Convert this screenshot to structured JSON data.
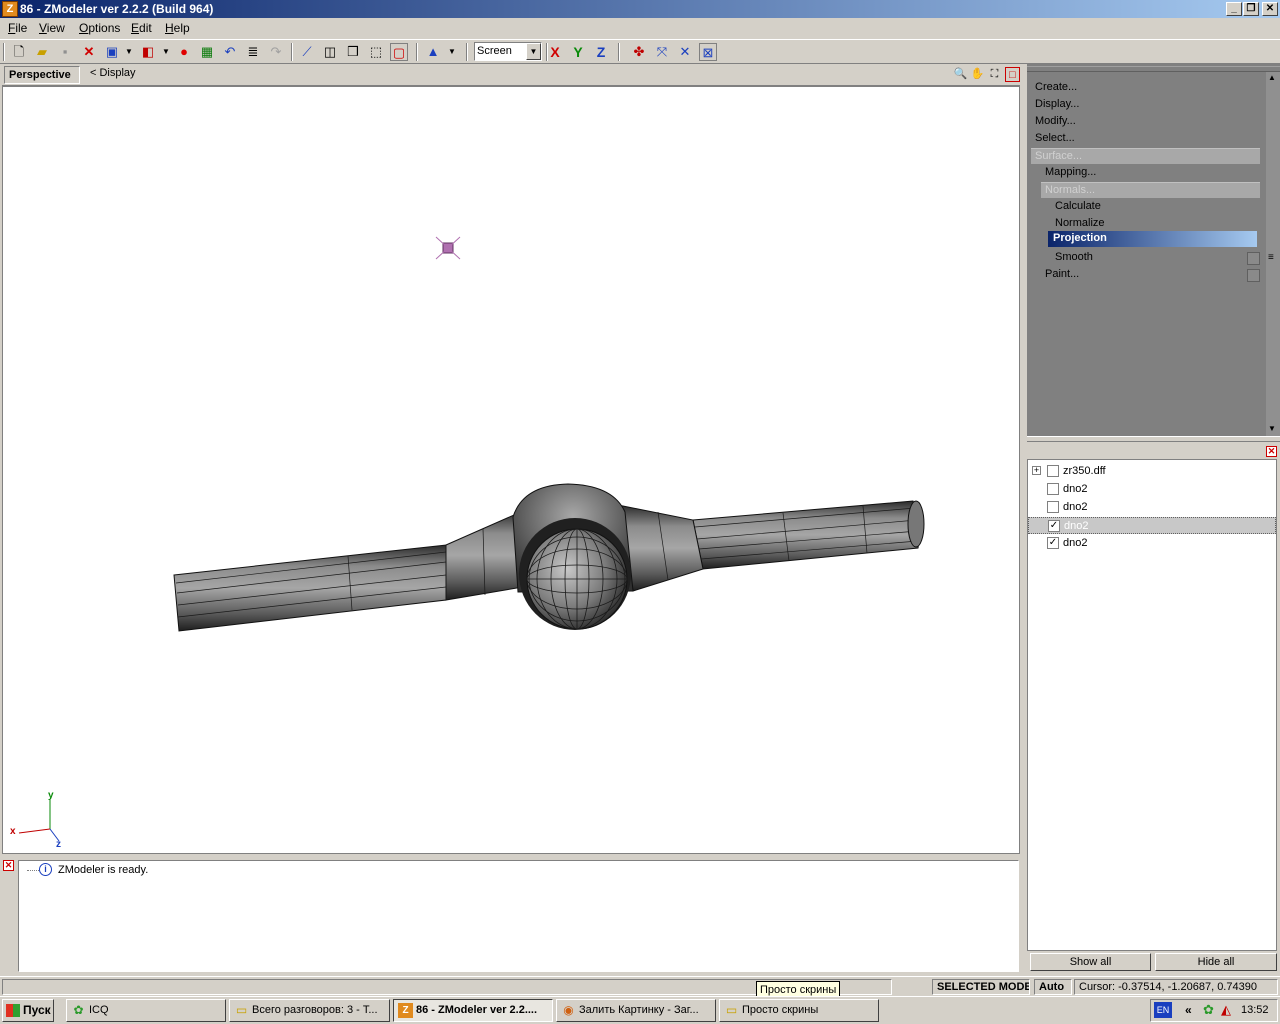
{
  "window": {
    "title": "86 - ZModeler ver 2.2.2 (Build 964)",
    "app_icon": "Z",
    "min": "_",
    "max": "❐",
    "close": "✕"
  },
  "menu": [
    "File",
    "View",
    "Options",
    "Edit",
    "Help"
  ],
  "toolbar": {
    "coord_system": "Screen",
    "axis_x": "X",
    "axis_y": "Y",
    "axis_z": "Z"
  },
  "viewport": {
    "tab": "Perspective",
    "display": "<  Display",
    "axis_x": "x",
    "axis_y": "y",
    "axis_z": "z"
  },
  "log": {
    "message": "ZModeler is ready.",
    "info_icon": "i"
  },
  "command_panel": {
    "items": [
      "Create...",
      "Display...",
      "Modify...",
      "Select..."
    ],
    "surface": "Surface...",
    "mapping": "Mapping...",
    "normals": "Normals...",
    "calculate": "Calculate",
    "normalize": "Normalize",
    "projection": "Projection",
    "smooth": "Smooth",
    "paint": "Paint..."
  },
  "object_tree": {
    "items": [
      {
        "label": "zr350.dff",
        "checked": false,
        "expandable": true
      },
      {
        "label": "dno2",
        "checked": false
      },
      {
        "label": "dno2",
        "checked": false
      },
      {
        "label": "dno2",
        "checked": true,
        "selected": true
      },
      {
        "label": "dno2",
        "checked": true
      }
    ],
    "expand_glyph": "+",
    "check_glyph": "✓",
    "show_all": "Show all",
    "hide_all": "Hide all"
  },
  "status": {
    "mode": "SELECTED MODE",
    "auto": "Auto",
    "cursor": "Cursor: -0.37514, -1.20687, 0.74390",
    "tooltip": "Просто скрины"
  },
  "taskbar": {
    "start": "Пуск",
    "tasks": [
      {
        "label": "ICQ",
        "icon": "✿"
      },
      {
        "label": "Всего разговоров: 3 - Т...",
        "icon": "▭"
      },
      {
        "label": "86 - ZModeler ver 2.2....",
        "icon": "Z",
        "active": true
      },
      {
        "label": "Залить Картинку - Заг...",
        "icon": "◉"
      },
      {
        "label": "Просто скрины",
        "icon": "▭"
      }
    ],
    "lang": "EN",
    "tray_arrow": "«",
    "clock": "13:52"
  }
}
